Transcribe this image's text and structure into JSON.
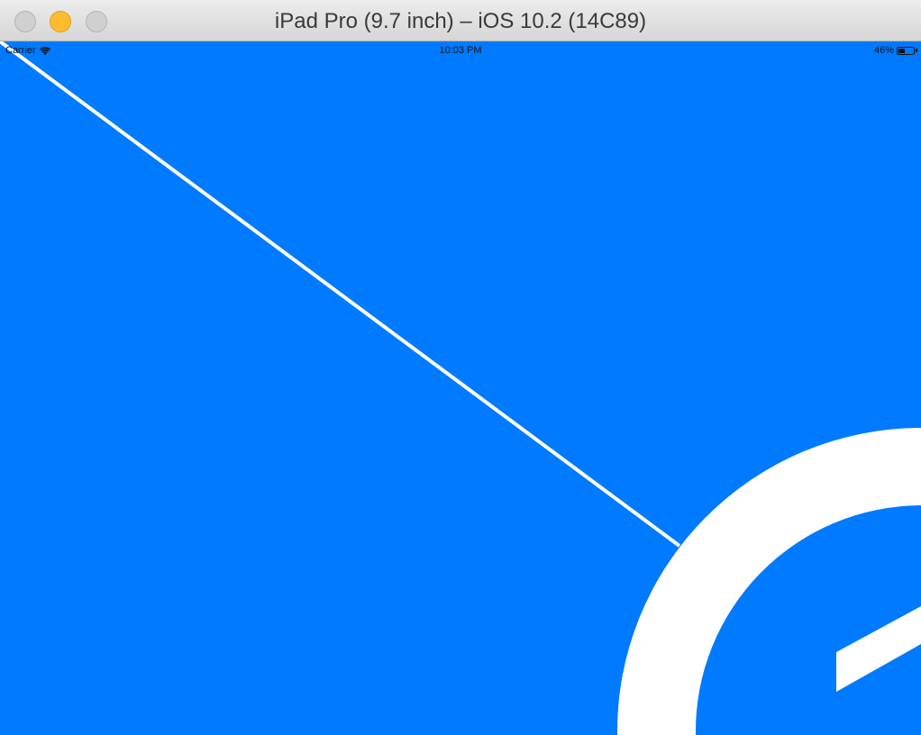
{
  "window": {
    "title": "iPad Pro (9.7 inch) – iOS 10.2 (14C89)"
  },
  "status_bar": {
    "carrier": "Carrier",
    "time": "10:03 PM",
    "battery_percent": "46%",
    "battery_level": 0.46
  },
  "colors": {
    "screen_background": "#007aff",
    "shapes": "#ffffff"
  }
}
